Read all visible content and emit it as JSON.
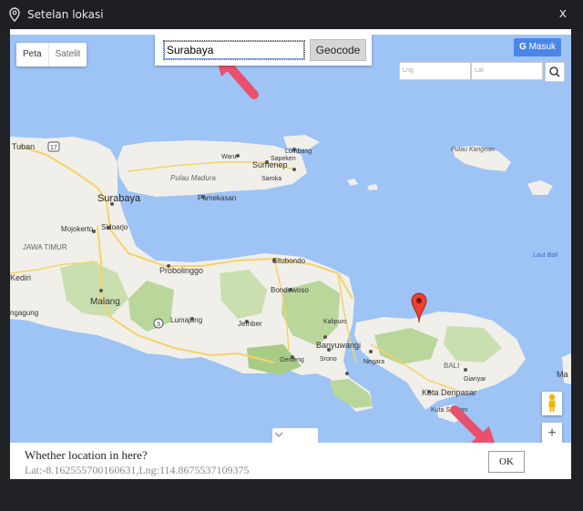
{
  "window": {
    "title": "Setelan lokasi",
    "close_glyph": "x"
  },
  "map": {
    "type_map": "Peta",
    "type_satellite": "Satelit",
    "search_value": "Surabaya",
    "geocode_label": "Geocode",
    "signin_label": "Masuk",
    "signin_icon": "G",
    "lng_placeholder": "Lng",
    "lat_placeholder": "Lat",
    "places": {
      "tuban": "Tuban",
      "surabaya": "Surabaya",
      "mojokerto": "Mojokerto",
      "sidoarjo": "Sidoarjo",
      "jawa_timur": "JAWA TIMUR",
      "kediri": "Kediri",
      "malang": "Malang",
      "ngagung": "ngagung",
      "lumajang": "Lumajang",
      "jember": "Jember",
      "probolinggo": "Probolinggo",
      "bondowoso": "Bondowoso",
      "situbondo": "Situbondo",
      "kalipuro": "Kalipuro",
      "banyuwangi": "Banyuwangi",
      "genteng": "Genteng",
      "srono": "Srono",
      "negara": "Negara",
      "bali": "BALI",
      "gianyar": "Gianyar",
      "kota_denpasar": "Kota Denpasar",
      "kuta_selatan": "Kuta Selatan",
      "waru": "Waru",
      "sumenep": "Sumenep",
      "lombang": "Lombang",
      "sapeken": "Sapeken",
      "saroka": "Saroka",
      "pulau_madura": "Pulau Madura",
      "pamekasan": "Pamekasan",
      "pulau_kangean": "Pulau Kangean",
      "laut_bali": "Laut Bali",
      "ma": "Ma",
      "route_17": "17",
      "route_3": "3"
    }
  },
  "footer": {
    "question": "Whether location in here?",
    "coords": "Lat:-8.162555700160631,Lng:114.8675537109375",
    "ok_label": "OK"
  }
}
